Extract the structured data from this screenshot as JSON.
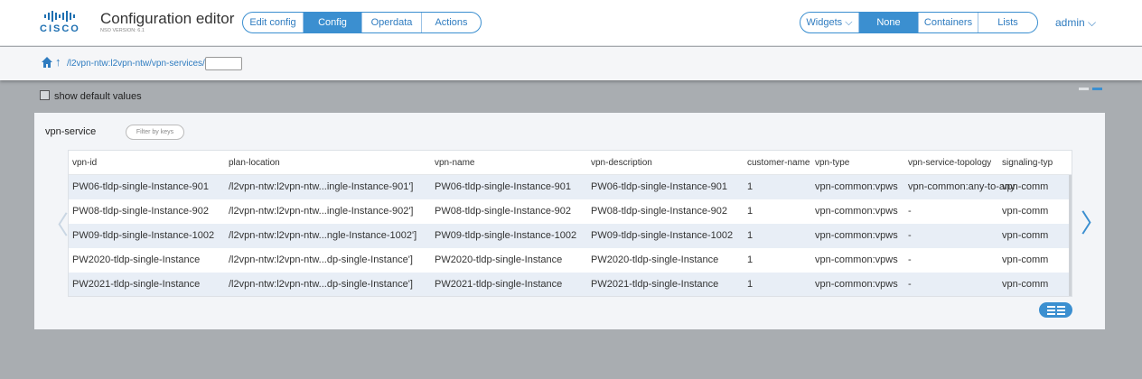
{
  "header": {
    "logo": "cisco",
    "title": "Configuration editor",
    "version": "NSO VERSION: 6.1",
    "mode_tabs": [
      {
        "label": "Edit config",
        "active": false
      },
      {
        "label": "Config",
        "active": true
      },
      {
        "label": "Operdata",
        "active": false
      },
      {
        "label": "Actions",
        "active": false
      }
    ],
    "widget_tabs": [
      {
        "label": "Widgets ⌵",
        "active": false
      },
      {
        "label": "None",
        "active": true
      },
      {
        "label": "Containers",
        "active": false
      },
      {
        "label": "Lists",
        "active": false
      }
    ],
    "user": "admin ⌵"
  },
  "breadcrumb": {
    "path": "/l2vpn-ntw:l2vpn-ntw/vpn-services/",
    "input_value": ""
  },
  "options": {
    "show_default_values": "show default values",
    "checked": false
  },
  "panel": {
    "title": "vpn-service",
    "filter_placeholder": "Filter by keys",
    "columns": [
      "vpn-id",
      "plan-location",
      "vpn-name",
      "vpn-description",
      "customer-name",
      "vpn-type",
      "vpn-service-topology",
      "signaling-typ"
    ],
    "rows": [
      [
        "PW06-tldp-single-Instance-901",
        "/l2vpn-ntw:l2vpn-ntw...ingle-Instance-901']",
        "PW06-tldp-single-Instance-901",
        "PW06-tldp-single-Instance-901",
        "1",
        "vpn-common:vpws",
        "vpn-common:any-to-any",
        "vpn-comm"
      ],
      [
        "PW08-tldp-single-Instance-902",
        "/l2vpn-ntw:l2vpn-ntw...ingle-Instance-902']",
        "PW08-tldp-single-Instance-902",
        "PW08-tldp-single-Instance-902",
        "1",
        "vpn-common:vpws",
        "-",
        "vpn-comm"
      ],
      [
        "PW09-tldp-single-Instance-1002",
        "/l2vpn-ntw:l2vpn-ntw...ngle-Instance-1002']",
        "PW09-tldp-single-Instance-1002",
        "PW09-tldp-single-Instance-1002",
        "1",
        "vpn-common:vpws",
        "-",
        "vpn-comm"
      ],
      [
        "PW2020-tldp-single-Instance",
        "/l2vpn-ntw:l2vpn-ntw...dp-single-Instance']",
        "PW2020-tldp-single-Instance",
        "PW2020-tldp-single-Instance",
        "1",
        "vpn-common:vpws",
        "-",
        "vpn-comm"
      ],
      [
        "PW2021-tldp-single-Instance",
        "/l2vpn-ntw:l2vpn-ntw...dp-single-Instance']",
        "PW2021-tldp-single-Instance",
        "PW2021-tldp-single-Instance",
        "1",
        "vpn-common:vpws",
        "-",
        "vpn-comm"
      ]
    ]
  }
}
